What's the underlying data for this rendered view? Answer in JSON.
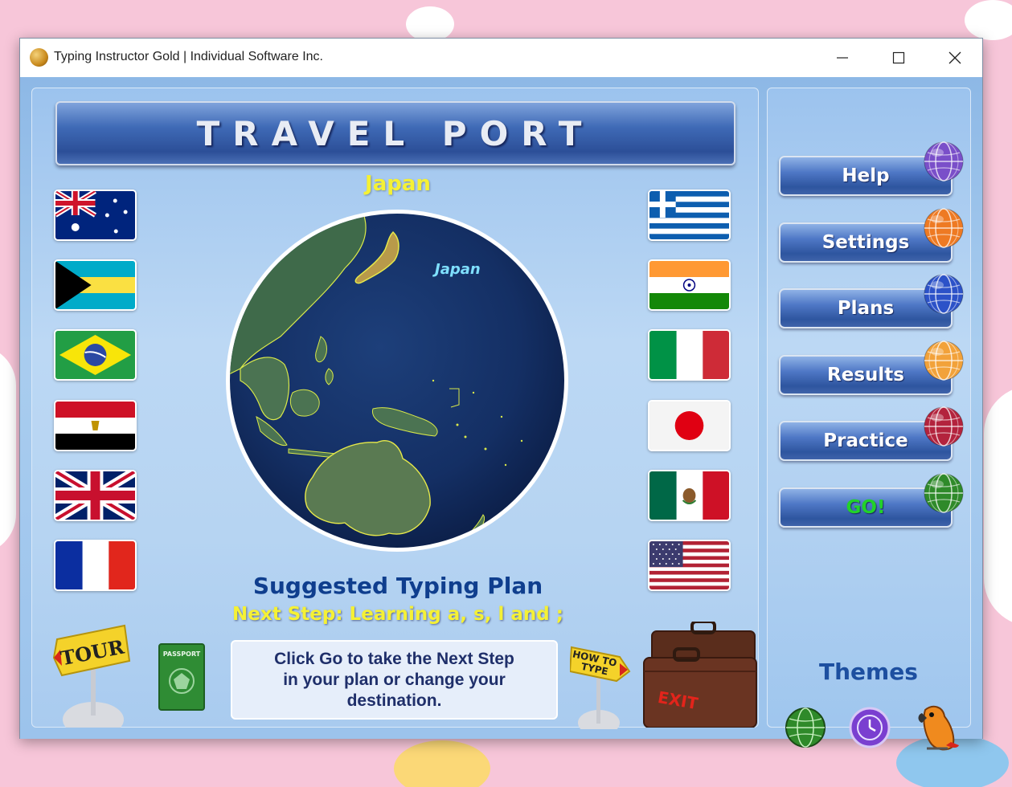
{
  "window": {
    "title": "Typing Instructor Gold | Individual Software Inc.",
    "controls": [
      "minimize",
      "maximize",
      "close"
    ]
  },
  "banner": {
    "title": "TRAVEL PORT"
  },
  "destination": {
    "selected": "Japan",
    "globe_label": "Japan"
  },
  "flags": {
    "left": [
      {
        "country": "australia",
        "icon": "australia-flag-icon"
      },
      {
        "country": "bahamas",
        "icon": "bahamas-flag-icon"
      },
      {
        "country": "brazil",
        "icon": "brazil-flag-icon"
      },
      {
        "country": "egypt",
        "icon": "egypt-flag-icon"
      },
      {
        "country": "united-kingdom",
        "icon": "uk-flag-icon"
      },
      {
        "country": "france",
        "icon": "france-flag-icon"
      }
    ],
    "right": [
      {
        "country": "greece",
        "icon": "greece-flag-icon"
      },
      {
        "country": "india",
        "icon": "india-flag-icon"
      },
      {
        "country": "italy",
        "icon": "italy-flag-icon"
      },
      {
        "country": "japan",
        "icon": "japan-flag-icon"
      },
      {
        "country": "mexico",
        "icon": "mexico-flag-icon"
      },
      {
        "country": "usa",
        "icon": "usa-flag-icon"
      }
    ]
  },
  "plan": {
    "title": "Suggested Typing Plan",
    "next_step": "Next Step: Learning a, s, l and ;",
    "instructions": "Click Go to take the Next Step in your plan or change your destination."
  },
  "signs": {
    "tour": "TOUR",
    "passport": "PASSPORT",
    "how_to_type_line1": "HOW TO",
    "how_to_type_line2": "TYPE",
    "exit": "EXIT"
  },
  "nav": [
    {
      "label": "Help",
      "globe_color": "#7a4fc9"
    },
    {
      "label": "Settings",
      "globe_color": "#ee7a23"
    },
    {
      "label": "Plans",
      "globe_color": "#2c52c8"
    },
    {
      "label": "Results",
      "globe_color": "#f2a23a"
    },
    {
      "label": "Practice",
      "globe_color": "#b3233d"
    },
    {
      "label": "GO!",
      "globe_color": "#2f8a2a",
      "label_color": "#22d12a"
    }
  ],
  "themes": {
    "label": "Themes",
    "icons": [
      "globe-theme-icon",
      "clock-theme-icon",
      "parrot-theme-icon"
    ]
  }
}
